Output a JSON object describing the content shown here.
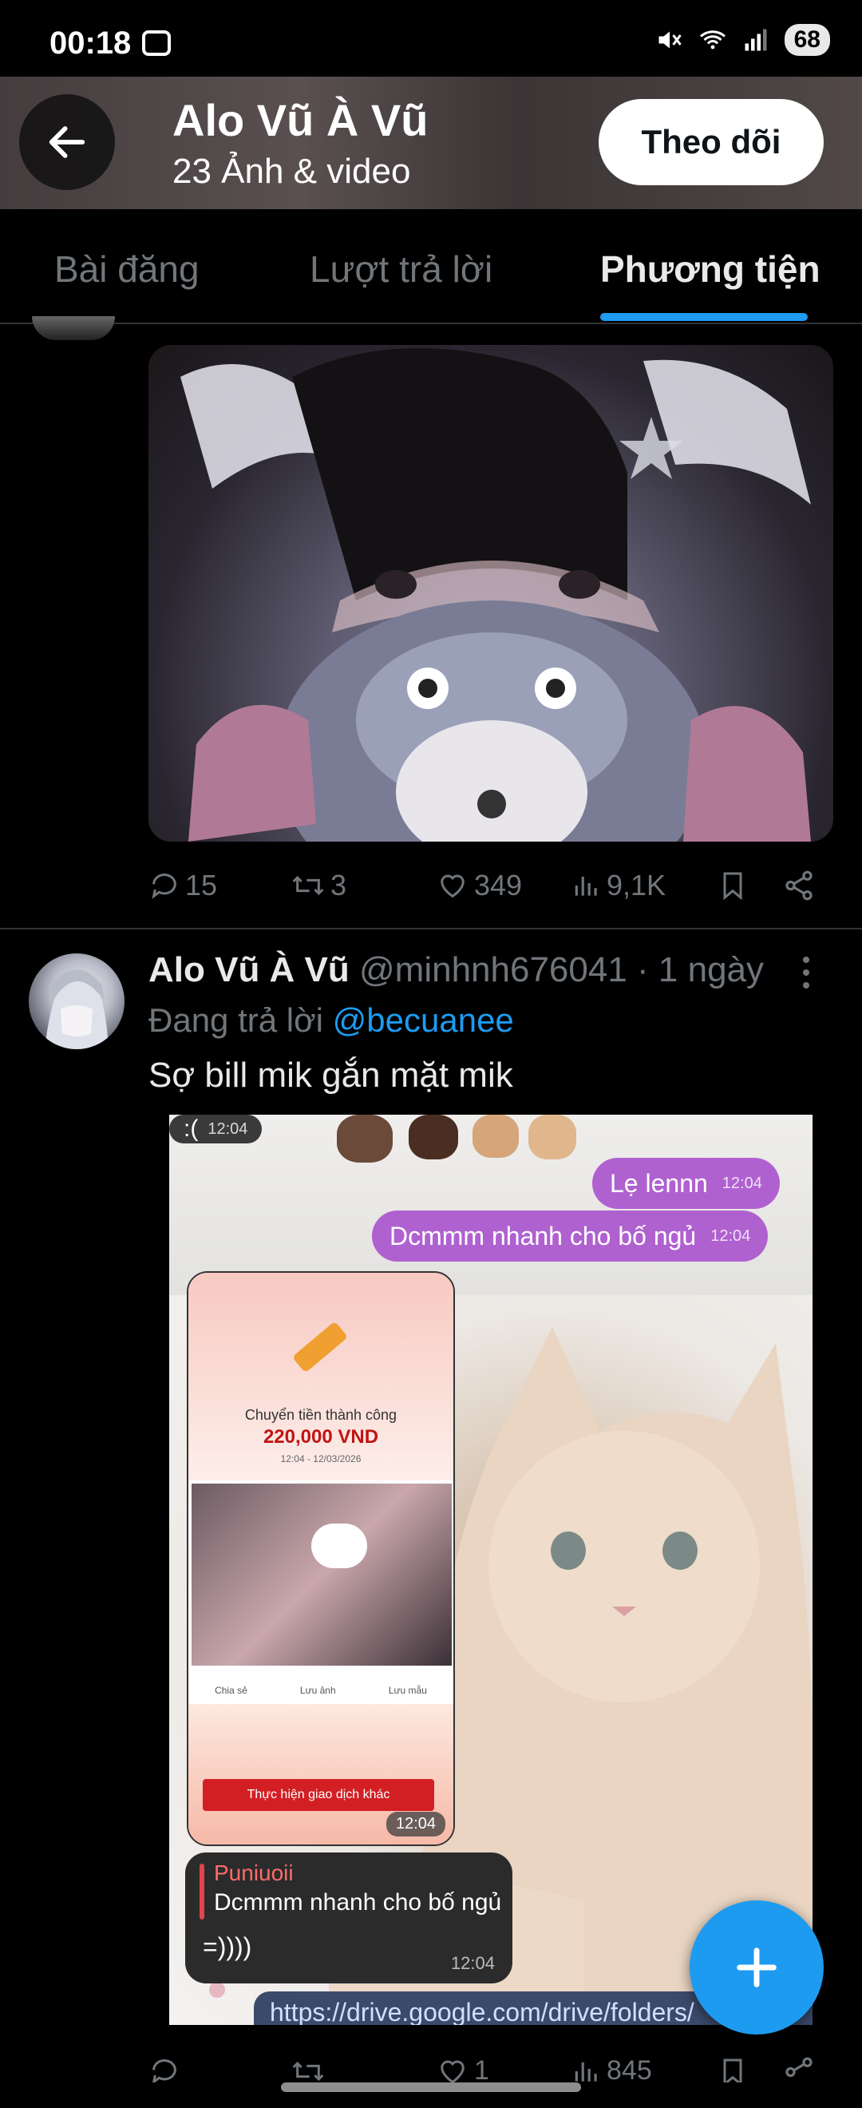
{
  "status_bar": {
    "time": "00:18",
    "battery": "68"
  },
  "header": {
    "title": "Alo Vũ À Vũ",
    "subtitle": "23 Ảnh & video",
    "follow_label": "Theo dõi"
  },
  "tabs": [
    {
      "label": "Bài đăng"
    },
    {
      "label": "Lượt trả lời"
    },
    {
      "label": "Phương tiện"
    }
  ],
  "post1": {
    "replies": "15",
    "reposts": "3",
    "likes": "349",
    "views": "9,1K"
  },
  "post2": {
    "name": "Alo Vũ À Vũ",
    "meta": "@minhnh676041 · 1 ngày",
    "reply_prefix": "Đang trả lời ",
    "reply_to": "@becuanee",
    "text": "Sợ bill mik gắn mặt mik",
    "image": {
      "msg_in_top": ":(",
      "msg_in_top_time": "12:04",
      "msg_out_1": "Lẹ lennn",
      "msg_out_1_time": "12:04",
      "msg_out_2": "Dcmmm nhanh cho bố ngủ",
      "msg_out_2_time": "12:04",
      "receipt_title": "Chuyển tiền thành công",
      "receipt_amount": "220,000 VND",
      "receipt_date": "12:04 - 12/03/2026",
      "receipt_opt_1": "Chia sẻ",
      "receipt_opt_2": "Lưu ảnh",
      "receipt_opt_3": "Lưu mẫu",
      "receipt_cta": "Thực hiện giao dịch khác",
      "receipt_time": "12:04",
      "quote_name": "Puniuoii",
      "quote_text": "Dcmmm nhanh cho bố ngủ",
      "quote_reply": "=))))",
      "quote_time": "12:04",
      "link": "https://drive.google.com/drive/folders/"
    },
    "likes": "1",
    "views": "845"
  },
  "colors": {
    "accent": "#1d9bf0",
    "background": "#000000",
    "muted": "#71767b",
    "text": "#e7e9ea"
  }
}
